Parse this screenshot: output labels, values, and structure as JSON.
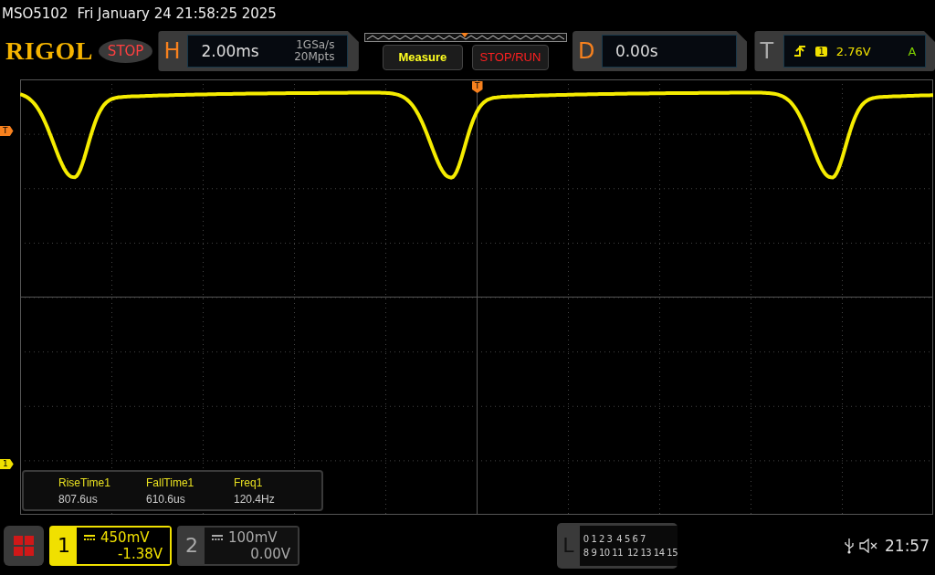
{
  "title_bar": {
    "model": "MSO5102",
    "datetime": "Fri January 24 21:58:25 2025"
  },
  "toolbar": {
    "logo": "RIGOL",
    "run_state": "STOP",
    "horizontal": {
      "label": "H",
      "timebase": "2.00ms",
      "sample_rate": "1GSa/s",
      "memory_depth": "20Mpts"
    },
    "buttons": [
      {
        "label": "Measure",
        "kind": "menu"
      },
      {
        "label": "STOP/RUN",
        "kind": "run"
      }
    ],
    "delay": {
      "label": "D",
      "value": "0.00s"
    },
    "trigger": {
      "label": "T",
      "channel": "1",
      "level": "2.76V",
      "mode": "A"
    }
  },
  "screen": {
    "trigger_level_marker": "T",
    "channel_marker": "1",
    "trigger_position_marker": "T",
    "measurements": [
      {
        "name": "RiseTime1",
        "value": "807.6us"
      },
      {
        "name": "FallTime1",
        "value": "610.6us"
      },
      {
        "name": "Freq1",
        "value": "120.4Hz"
      }
    ]
  },
  "bottom_bar": {
    "channels": [
      {
        "number": "1",
        "scale": "450mV",
        "offset": "-1.38V",
        "active": true
      },
      {
        "number": "2",
        "scale": "100mV",
        "offset": "0.00V",
        "active": false
      }
    ],
    "logic": {
      "label": "L",
      "rows": [
        [
          "0 1 2 3",
          "4 5 6 7"
        ],
        [
          "8 9 10 11",
          "12 13 14 15"
        ]
      ]
    },
    "clock": "21:57"
  }
}
